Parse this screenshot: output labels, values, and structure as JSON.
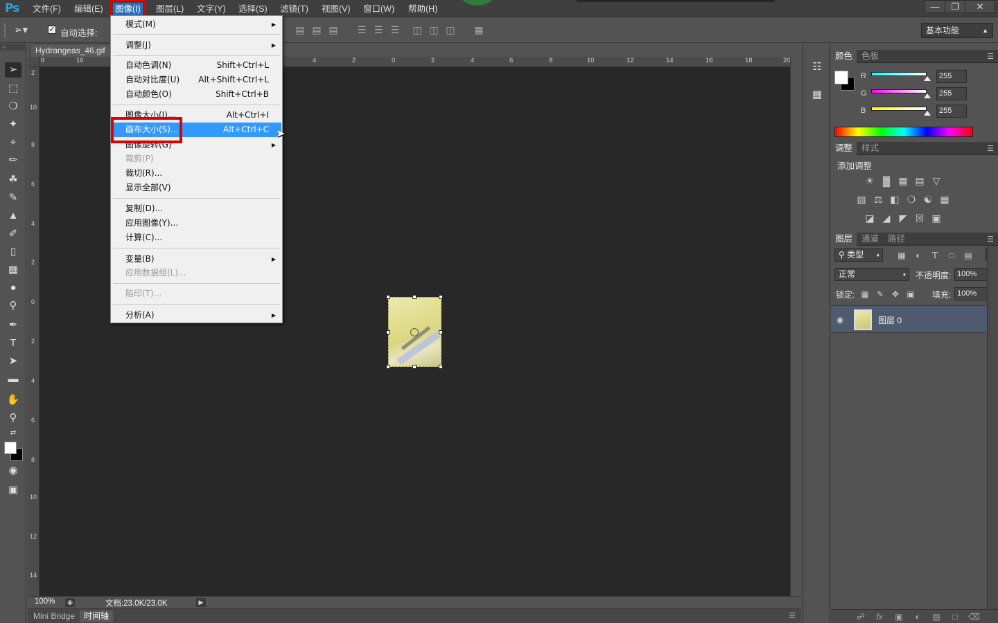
{
  "app": {
    "logo": "Ps",
    "menus": [
      "文件(F)",
      "编辑(E)",
      "图像(I)",
      "图层(L)",
      "文字(Y)",
      "选择(S)",
      "滤镜(T)",
      "视图(V)",
      "窗口(W)",
      "帮助(H)"
    ],
    "active_menu": "图像(I)",
    "window_buttons": [
      "minimize-icon",
      "restore-icon",
      "close-icon"
    ]
  },
  "options_bar": {
    "auto_select_label": "自动选择:",
    "workspace": "基本功能"
  },
  "document": {
    "tab_title": "Hydrangeas_46.gif",
    "zoom": "100%",
    "doc_info": "文档:23.0K/23.0K",
    "ruler_h_labels": [
      "8",
      "16",
      "4",
      "2",
      "0",
      "2",
      "4",
      "6",
      "8",
      "10",
      "12",
      "14",
      "16",
      "18",
      "20"
    ],
    "ruler_v_labels": [
      "2",
      "10",
      "8",
      "6",
      "4",
      "2",
      "0",
      "2",
      "4",
      "6",
      "8",
      "10",
      "12",
      "14"
    ]
  },
  "bottom_tabs": [
    "Mini Bridge",
    "时间轴"
  ],
  "image_menu": {
    "items": [
      {
        "label": "模式(M)",
        "shortcut": "",
        "submenu": true,
        "disabled": false
      },
      {
        "label": "调整(J)",
        "shortcut": "",
        "submenu": true,
        "disabled": false
      },
      {
        "label": "自动色调(N)",
        "shortcut": "Shift+Ctrl+L",
        "submenu": false,
        "disabled": false
      },
      {
        "label": "自动对比度(U)",
        "shortcut": "Alt+Shift+Ctrl+L",
        "submenu": false,
        "disabled": false
      },
      {
        "label": "自动颜色(O)",
        "shortcut": "Shift+Ctrl+B",
        "submenu": false,
        "disabled": false
      },
      {
        "label": "图像大小(I)...",
        "shortcut": "Alt+Ctrl+I",
        "submenu": false,
        "disabled": false
      },
      {
        "label": "画布大小(S)...",
        "shortcut": "Alt+Ctrl+C",
        "submenu": false,
        "disabled": false,
        "highlighted": true
      },
      {
        "label": "图像旋转(G)",
        "shortcut": "",
        "submenu": true,
        "disabled": false
      },
      {
        "label": "裁剪(P)",
        "shortcut": "",
        "submenu": false,
        "disabled": true
      },
      {
        "label": "裁切(R)...",
        "shortcut": "",
        "submenu": false,
        "disabled": false
      },
      {
        "label": "显示全部(V)",
        "shortcut": "",
        "submenu": false,
        "disabled": false
      },
      {
        "label": "复制(D)...",
        "shortcut": "",
        "submenu": false,
        "disabled": false
      },
      {
        "label": "应用图像(Y)...",
        "shortcut": "",
        "submenu": false,
        "disabled": false
      },
      {
        "label": "计算(C)...",
        "shortcut": "",
        "submenu": false,
        "disabled": false
      },
      {
        "label": "变量(B)",
        "shortcut": "",
        "submenu": true,
        "disabled": false
      },
      {
        "label": "应用数据组(L)...",
        "shortcut": "",
        "submenu": false,
        "disabled": true
      },
      {
        "label": "陷印(T)...",
        "shortcut": "",
        "submenu": false,
        "disabled": true
      },
      {
        "label": "分析(A)",
        "shortcut": "",
        "submenu": true,
        "disabled": false
      }
    ]
  },
  "color_panel": {
    "tabs": [
      "颜色",
      "色板"
    ],
    "channels": [
      {
        "label": "R",
        "value": "255"
      },
      {
        "label": "G",
        "value": "255"
      },
      {
        "label": "B",
        "value": "255"
      }
    ]
  },
  "adjustments_panel": {
    "tabs": [
      "调整",
      "样式"
    ],
    "title": "添加调整"
  },
  "layers_panel": {
    "tabs": [
      "图层",
      "通道",
      "路径"
    ],
    "filter_kind": "类型",
    "blend_mode": "正常",
    "opacity_label": "不透明度:",
    "opacity_value": "100%",
    "lock_label": "锁定:",
    "fill_label": "填充:",
    "fill_value": "100%",
    "layers": [
      {
        "name": "图层 0",
        "visible": true
      }
    ]
  },
  "colors": {
    "accent": "#3399ff",
    "highlight_box": "#e00000",
    "canvas_bg": "#282828",
    "panel_bg": "#535353"
  }
}
